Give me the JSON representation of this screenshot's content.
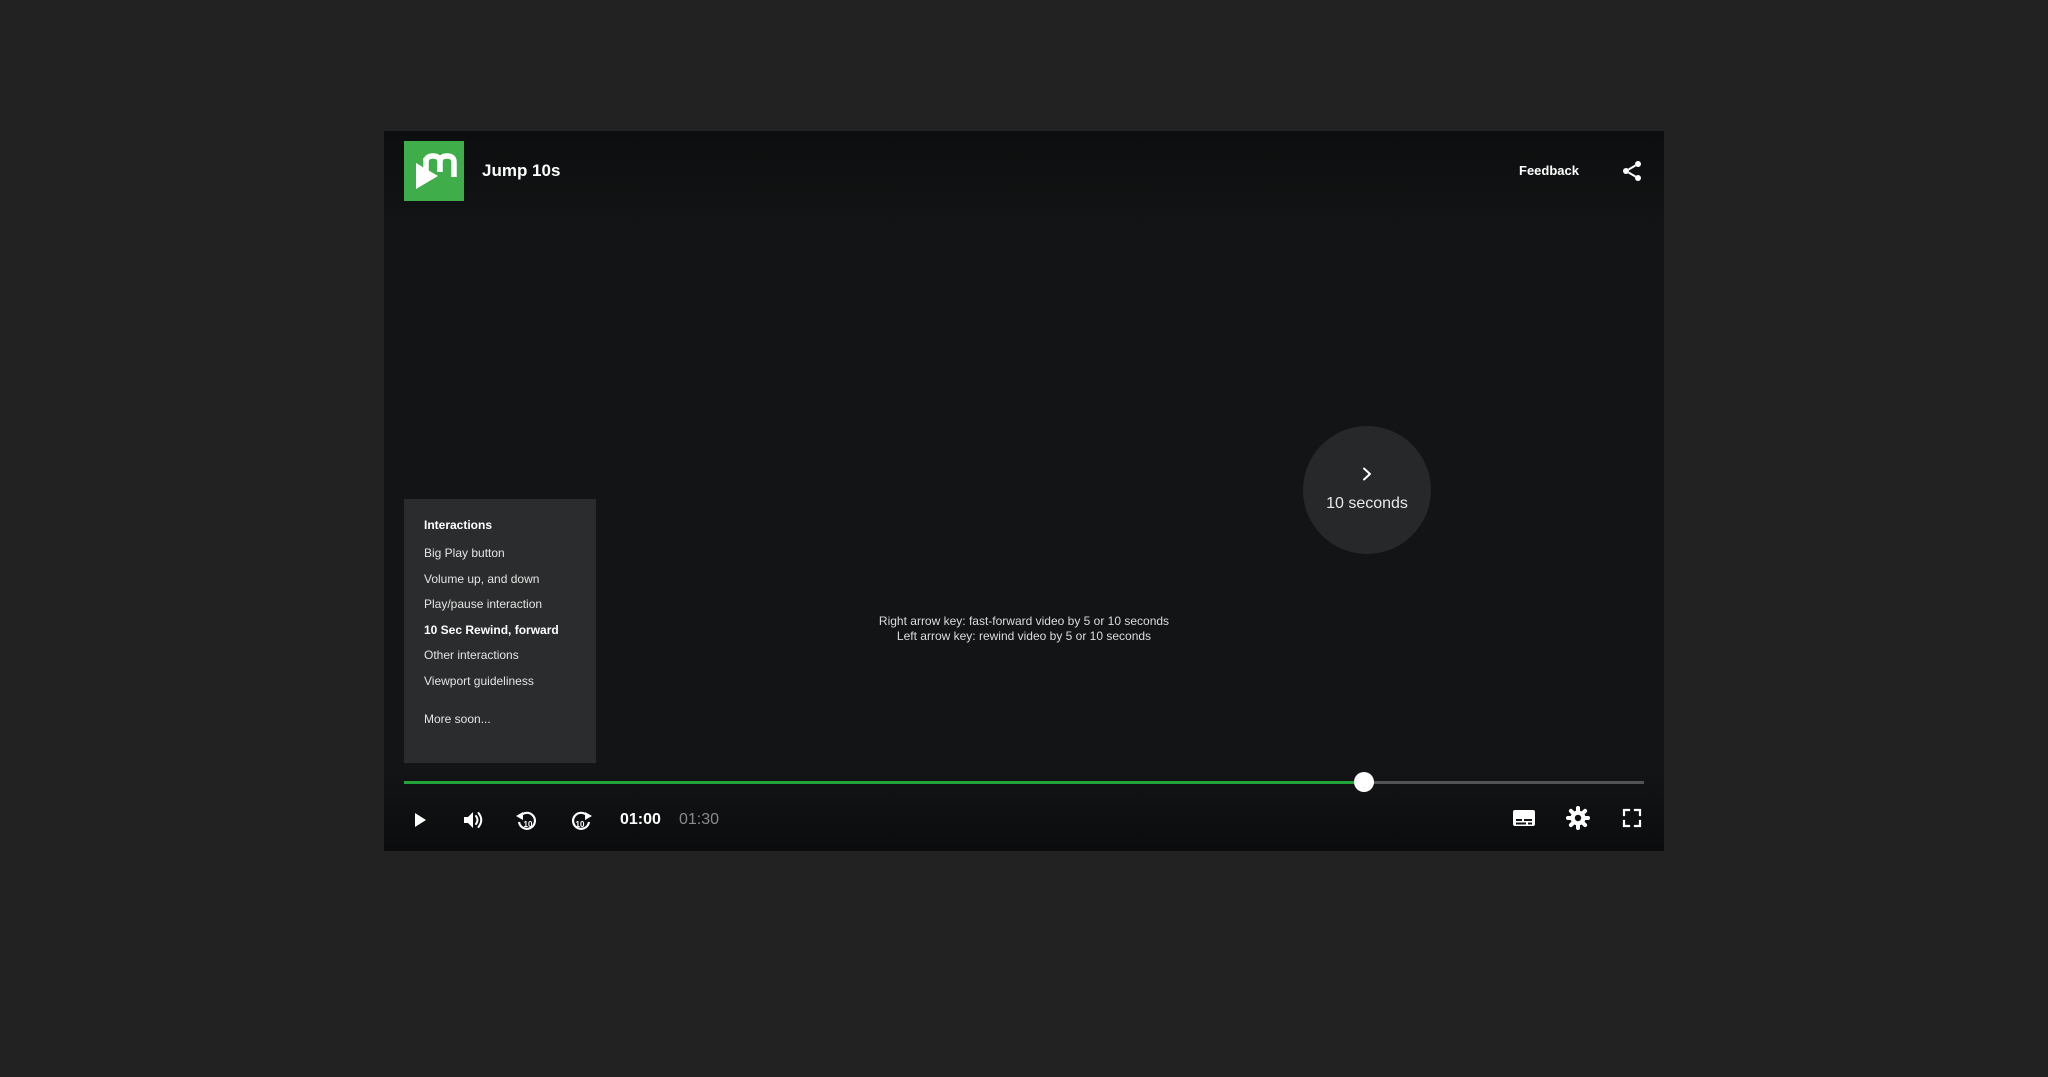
{
  "header": {
    "title": "Jump 10s",
    "feedback_label": "Feedback"
  },
  "interactions_menu": {
    "heading": "Interactions",
    "items": [
      {
        "label": "Big Play button",
        "active": false
      },
      {
        "label": "Volume up, and down",
        "active": false
      },
      {
        "label": "Play/pause interaction",
        "active": false
      },
      {
        "label": "10 Sec Rewind, forward",
        "active": true
      },
      {
        "label": "Other interactions",
        "active": false
      },
      {
        "label": "Viewport guideliness",
        "active": false
      }
    ],
    "more_label": "More soon..."
  },
  "skip_indicator": {
    "label": "10 seconds"
  },
  "hints": {
    "line1": "Right arrow key: fast-forward video by 5 or 10 seconds",
    "line2": "Left arrow key: rewind video by 5 or 10 seconds"
  },
  "playback": {
    "current_time": "01:00",
    "total_time": "01:30",
    "progress_fraction": 0.774
  },
  "icons": {
    "logo": "brand-logo-icon",
    "share": "share-icon",
    "skip": "chevron-right-icon",
    "play": "play-icon",
    "volume": "volume-icon",
    "rewind": "rewind-10-icon",
    "forward": "forward-10-icon",
    "captions": "captions-icon",
    "settings": "gear-icon",
    "fullscreen": "fullscreen-icon"
  },
  "colors": {
    "brand": "#3fae4a",
    "progress": "#21a33a",
    "page_background": "#222222",
    "player_background": "#121415"
  }
}
